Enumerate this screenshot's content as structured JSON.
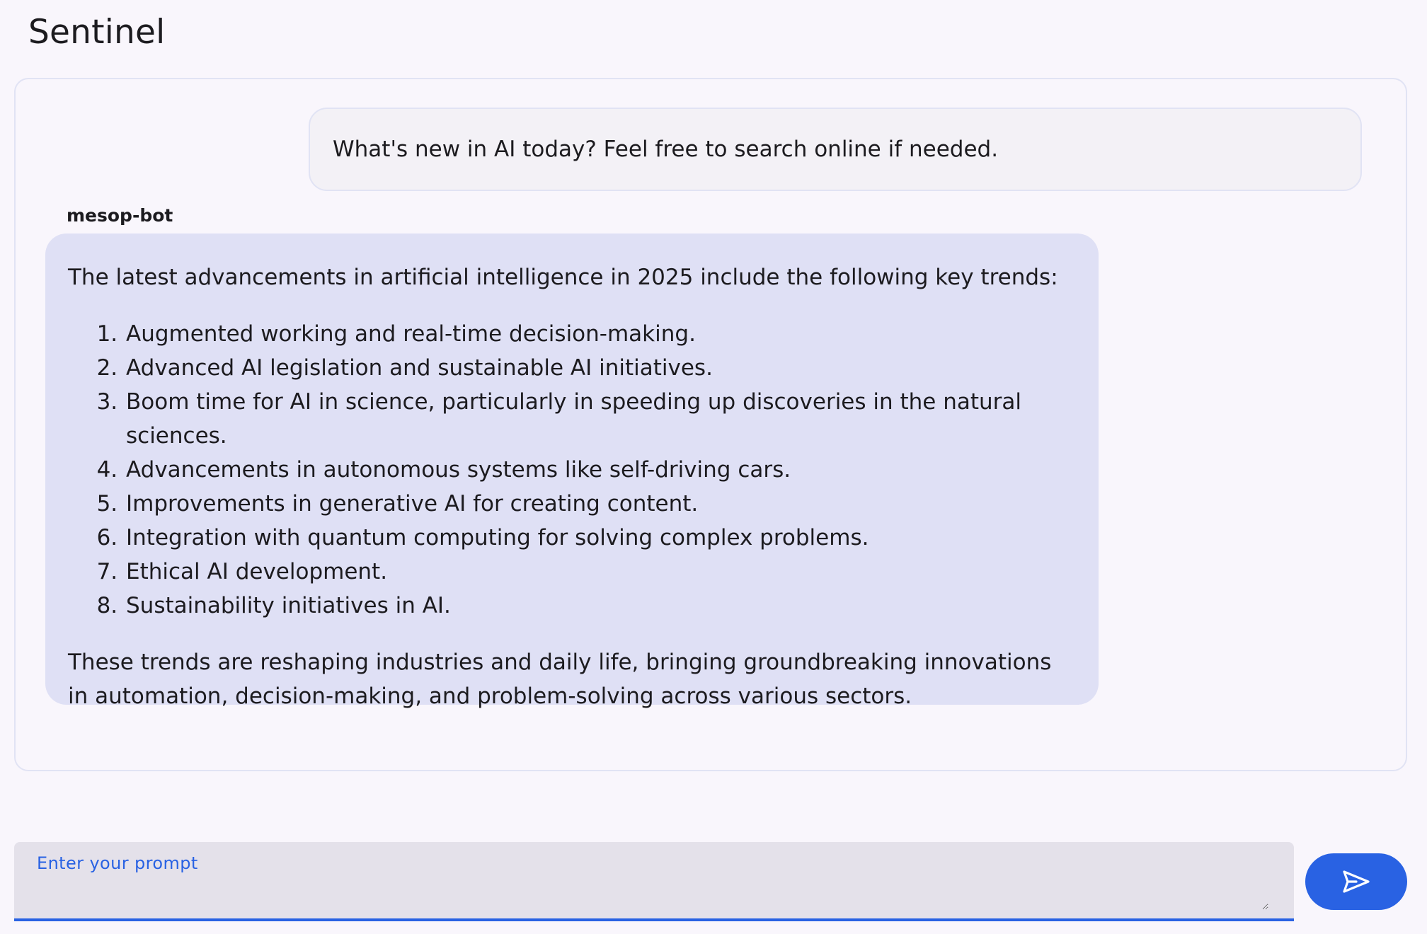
{
  "app": {
    "title": "Sentinel"
  },
  "chat": {
    "user_message": "What's new in AI today? Feel free to search online if needed.",
    "bot_name": "mesop-bot",
    "bot_intro": "The latest advancements in artificial intelligence in 2025 include the following key trends:",
    "bot_list": [
      "Augmented working and real-time decision-making.",
      "Advanced AI legislation and sustainable AI initiatives.",
      "Boom time for AI in science, particularly in speeding up discoveries in the natural sciences.",
      "Advancements in autonomous systems like self-driving cars.",
      "Improvements in generative AI for creating content.",
      "Integration with quantum computing for solving complex problems.",
      "Ethical AI development.",
      "Sustainability initiatives in AI."
    ],
    "bot_outro": "These trends are reshaping industries and daily life, bringing groundbreaking innovations in automation, decision-making, and problem-solving across various sectors."
  },
  "prompt": {
    "label": "Enter your prompt",
    "value": ""
  },
  "send_button": {
    "icon": "send-icon"
  },
  "colors": {
    "background": "#f9f6fc",
    "user_bubble": "#f3f1f6",
    "bot_bubble": "#dfe0f5",
    "accent": "#2962e3",
    "input_background": "#e4e1ea"
  }
}
